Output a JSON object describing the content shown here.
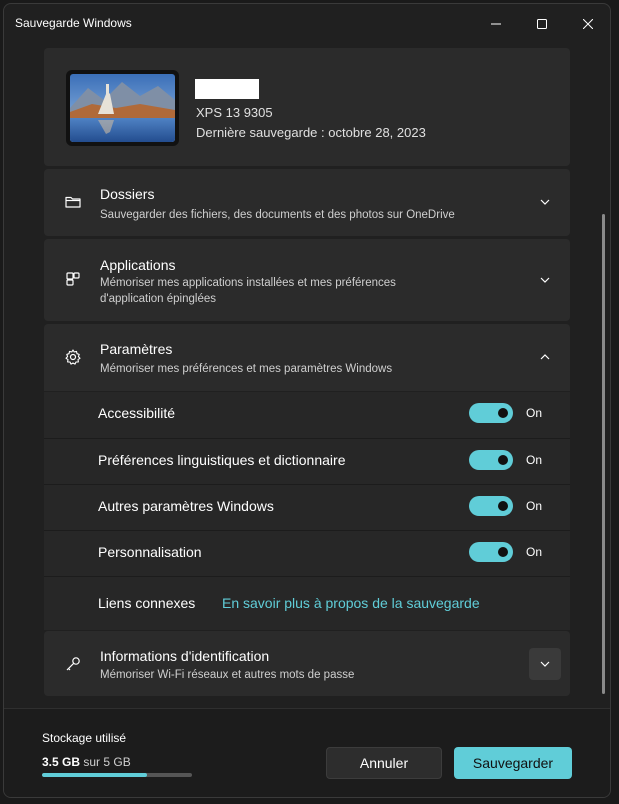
{
  "window": {
    "title": "Sauvegarde Windows"
  },
  "device": {
    "model": "XPS 13 9305",
    "last_backup": "Dernière sauvegarde : octobre 28, 2023"
  },
  "sections": {
    "dossiers": {
      "title": "Dossiers",
      "desc": "Sauvegarder des fichiers, des documents et des photos sur OneDrive",
      "icon": "folder-icon",
      "expanded": false
    },
    "applications": {
      "title": "Applications",
      "desc_line1": "Mémoriser mes applications installées et mes préférences",
      "desc_line2": "d'application épinglées",
      "icon": "apps-icon",
      "expanded": false
    },
    "parametres": {
      "title": "Paramètres",
      "desc": "Mémoriser mes préférences et mes paramètres Windows",
      "icon": "gear-icon",
      "expanded": true,
      "items": [
        {
          "label": "Accessibilité",
          "state": "On",
          "on": true
        },
        {
          "label": "Préférences linguistiques et dictionnaire",
          "state": "On",
          "on": true
        },
        {
          "label": "Autres paramètres Windows",
          "state": "On",
          "on": true
        },
        {
          "label": "Personnalisation",
          "state": "On",
          "on": true
        }
      ],
      "related_label": "Liens connexes",
      "related_link": "En savoir plus à propos de la sauvegarde"
    },
    "identification": {
      "title": "Informations d'identification",
      "desc": "Mémoriser Wi-Fi réseaux et autres mots de passe",
      "icon": "key-icon",
      "expanded": false
    }
  },
  "storage": {
    "label": "Stockage utilisé",
    "used": "3.5 GB",
    "of": "sur 5 GB",
    "fraction": 0.7
  },
  "buttons": {
    "cancel": "Annuler",
    "save": "Sauvegarder"
  },
  "colors": {
    "accent": "#60cdd8",
    "background": "#202020",
    "card": "#2b2b2b"
  }
}
